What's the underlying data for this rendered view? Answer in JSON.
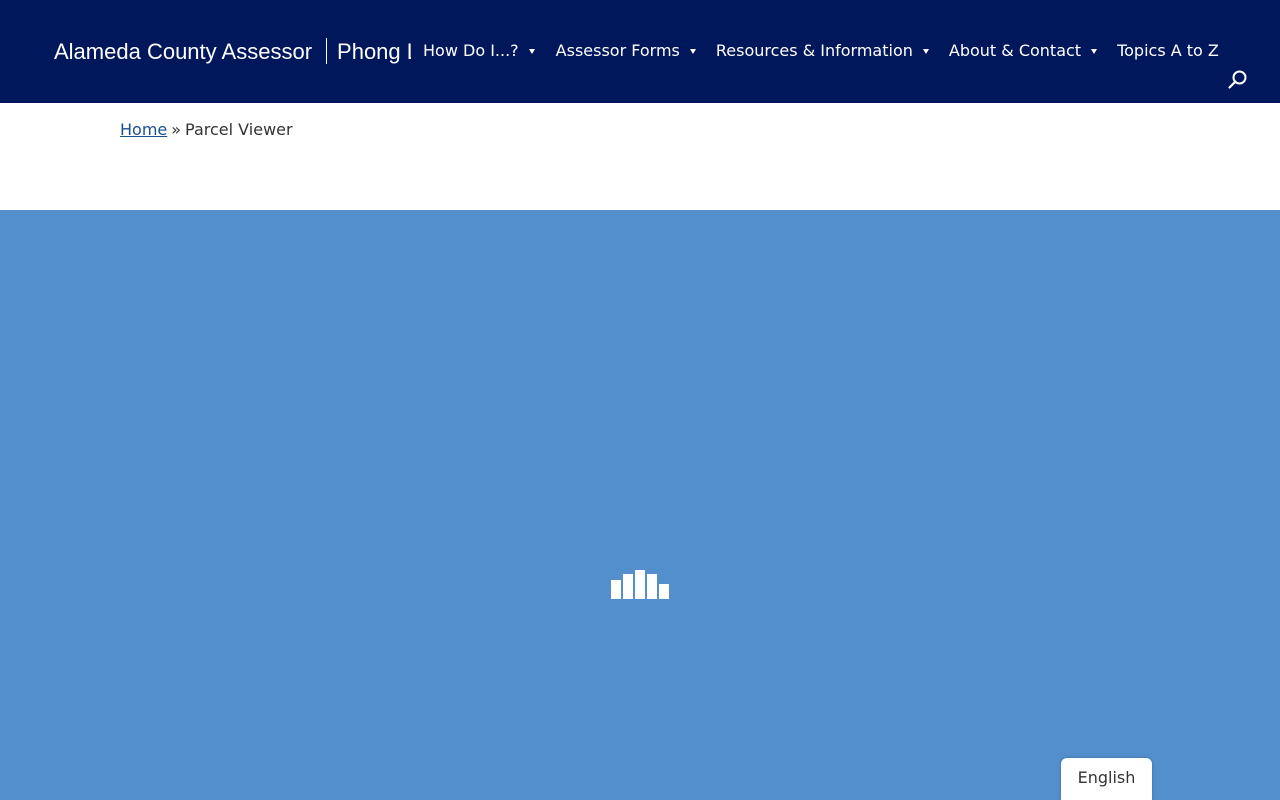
{
  "header": {
    "site_title": "Alameda County Assessor",
    "assessor_name": "Phong La"
  },
  "nav": {
    "items": [
      {
        "label": "How Do I...?",
        "has_dropdown": true
      },
      {
        "label": "Assessor Forms",
        "has_dropdown": true
      },
      {
        "label": "Resources & Information",
        "has_dropdown": true
      },
      {
        "label": "About & Contact",
        "has_dropdown": true
      },
      {
        "label": "Topics A to Z",
        "has_dropdown": false
      }
    ],
    "search_icon": "search-icon"
  },
  "breadcrumb": {
    "home": "Home",
    "separator": "»",
    "current": "Parcel Viewer"
  },
  "viewer": {
    "loading_icon": "loading-bars-icon"
  },
  "language": {
    "selected": "English"
  },
  "colors": {
    "header_bg": "#00175c",
    "viewer_bg": "#538fcc",
    "link": "#1b4f8f"
  }
}
